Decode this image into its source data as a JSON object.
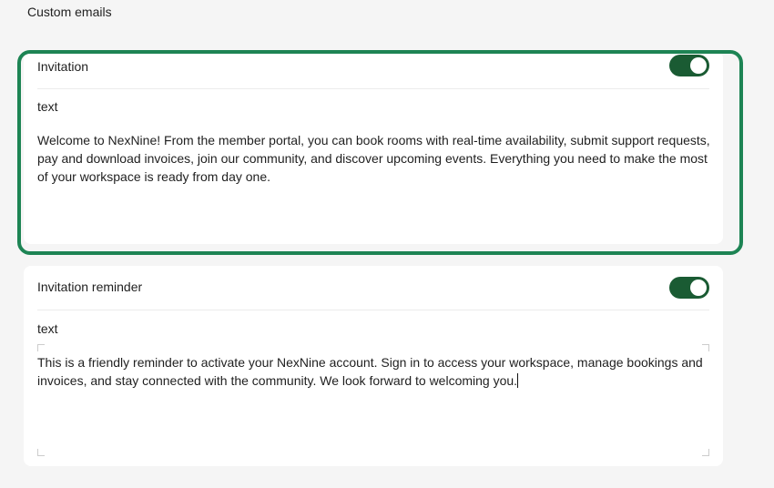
{
  "section": {
    "title": "Custom emails"
  },
  "emails": [
    {
      "title": "Invitation",
      "enabled": true,
      "field_label": "text",
      "body": "Welcome to NexNine! From the member portal, you can book rooms with real-time availability, submit support requests, pay and download invoices, join our community, and discover upcoming events. Everything you need to make the most of your workspace is ready from day one."
    },
    {
      "title": "Invitation reminder",
      "enabled": true,
      "field_label": "text",
      "body": "This is a friendly reminder to activate your NexNine account. Sign in to access your workspace, manage bookings and invoices, and stay connected with the community. We look forward to welcoming you."
    }
  ],
  "colors": {
    "toggle_on": "#1a5b33",
    "highlight": "#1d8454",
    "background": "#f5f5f5"
  }
}
